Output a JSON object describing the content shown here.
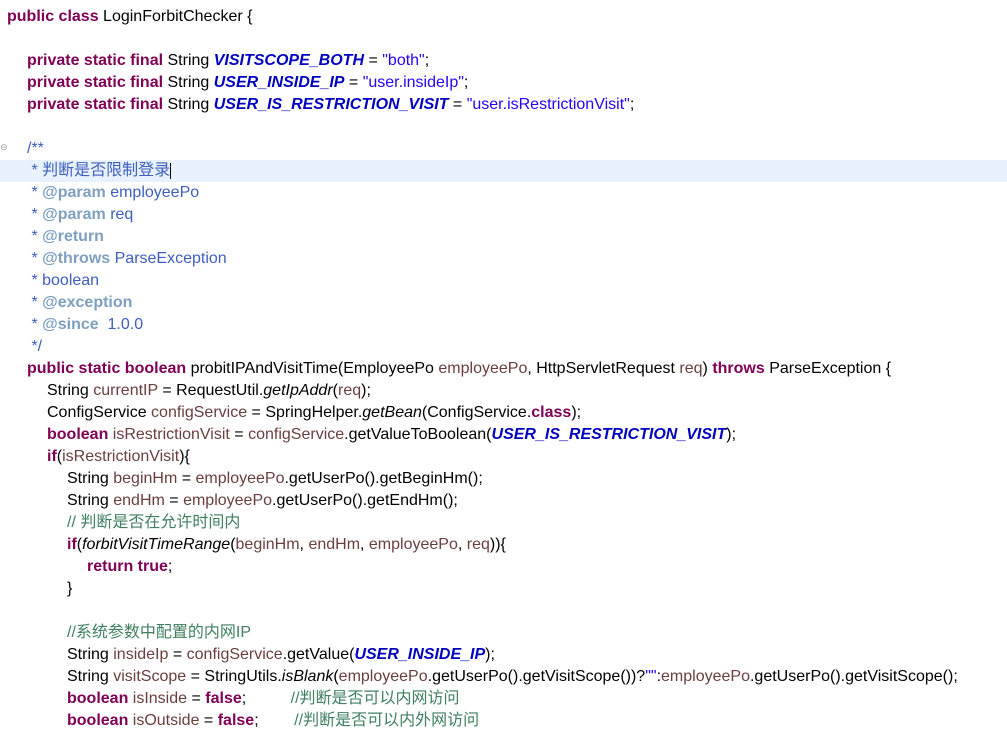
{
  "lines": {
    "l1": {
      "a": "public class ",
      "b": "LoginForbitChecker {"
    },
    "l3": {
      "a": "private static final ",
      "b": "String ",
      "c": "VISITSCOPE_BOTH",
      "d": " = ",
      "e": "\"both\"",
      "f": ";"
    },
    "l4": {
      "a": "private static final ",
      "b": "String ",
      "c": "USER_INSIDE_IP",
      "d": " = ",
      "e": "\"user.insideIp\"",
      "f": ";"
    },
    "l5": {
      "a": "private static final ",
      "b": "String ",
      "c": "USER_IS_RESTRICTION_VISIT",
      "d": " = ",
      "e": "\"user.isRestrictionVisit\"",
      "f": ";"
    },
    "l7": {
      "a": "/**"
    },
    "l8": {
      "a": " * 判断是否限制登录"
    },
    "l9": {
      "a": " * ",
      "b": "@param",
      "c": " employeePo"
    },
    "l10": {
      "a": " * ",
      "b": "@param",
      "c": " req"
    },
    "l11": {
      "a": " * ",
      "b": "@return"
    },
    "l12": {
      "a": " * ",
      "b": "@throws",
      "c": " ParseException"
    },
    "l13": {
      "a": " * boolean"
    },
    "l14": {
      "a": " * ",
      "b": "@exception"
    },
    "l15": {
      "a": " * ",
      "b": "@since",
      "c": "  1.0.0"
    },
    "l16": {
      "a": " */"
    },
    "l17": {
      "a": "public static boolean ",
      "b": "probitIPAndVisitTime(EmployeePo ",
      "c": "employeePo",
      ",": ", HttpServletRequest ",
      "d": "req",
      ")": ") ",
      "e": "throws ",
      "f": "ParseException {"
    },
    "l18": {
      "a": "String ",
      "b": "currentIP",
      " ": " = RequestUtil.",
      "c": "getIpAddr",
      "d": "(",
      "e": "req",
      "f": ");"
    },
    "l19": {
      "a": "ConfigService ",
      "b": "configService",
      " ": " = SpringHelper.",
      "c": "getBean",
      "d": "(ConfigService.",
      "e": "class",
      "f": ");"
    },
    "l20": {
      "a": "boolean ",
      "b": "isRestrictionVisit",
      " ": " = ",
      "c": "configService",
      ".": ".getValueToBoolean(",
      "d": "USER_IS_RESTRICTION_VISIT",
      "f": ");"
    },
    "l21": {
      "a": "if",
      "b": "(",
      "c": "isRestrictionVisit",
      "d": "){"
    },
    "l22": {
      "a": "String ",
      "b": "beginHm",
      " ": " = ",
      "c": "employeePo",
      "d": ".getUserPo().getBeginHm();"
    },
    "l23": {
      "a": "String ",
      "b": "endHm",
      " ": " = ",
      "c": "employeePo",
      "d": ".getUserPo().getEndHm();"
    },
    "l24": {
      "a": "// 判断是否在允许时间内"
    },
    "l25": {
      "a": "if",
      "b": "(",
      "c": "forbitVisitTimeRange",
      "d": "(",
      "e": "beginHm",
      ",": ", ",
      "f": "endHm",
      ",2": ", ",
      "g": "employeePo",
      ",3": ", ",
      "h": "req",
      "i": ")){"
    },
    "l26": {
      "a": "return ",
      "b": "true",
      ";": ";"
    },
    "l27": {
      "a": "}"
    },
    "l29": {
      "a": "//系统参数中配置的内网IP"
    },
    "l30": {
      "a": "String ",
      "b": "insideIp",
      " ": " = ",
      "c": "configService",
      "d": ".getValue(",
      "e": "USER_INSIDE_IP",
      "f": ");"
    },
    "l31": {
      "a": "String ",
      "b": "visitScope",
      " ": " = StringUtils.",
      "c": "isBlank",
      "d": "(",
      "e": "employeePo",
      "f": ".getUserPo().getVisitScope())?",
      "g": "\"\"",
      "h": ":",
      "i": "employeePo",
      "j": ".getUserPo().getVisitScope();"
    },
    "l32": {
      "a": "boolean ",
      "b": "isInside",
      " ": " = ",
      "c": "false",
      ";": ";",
      "sp": "          ",
      "d": "//判断是否可以内网访问"
    },
    "l33": {
      "a": "boolean ",
      "b": "isOutside",
      " ": " = ",
      "c": "false",
      ";": ";",
      "sp": "        ",
      "d": "//判断是否可以内外网访问"
    }
  }
}
